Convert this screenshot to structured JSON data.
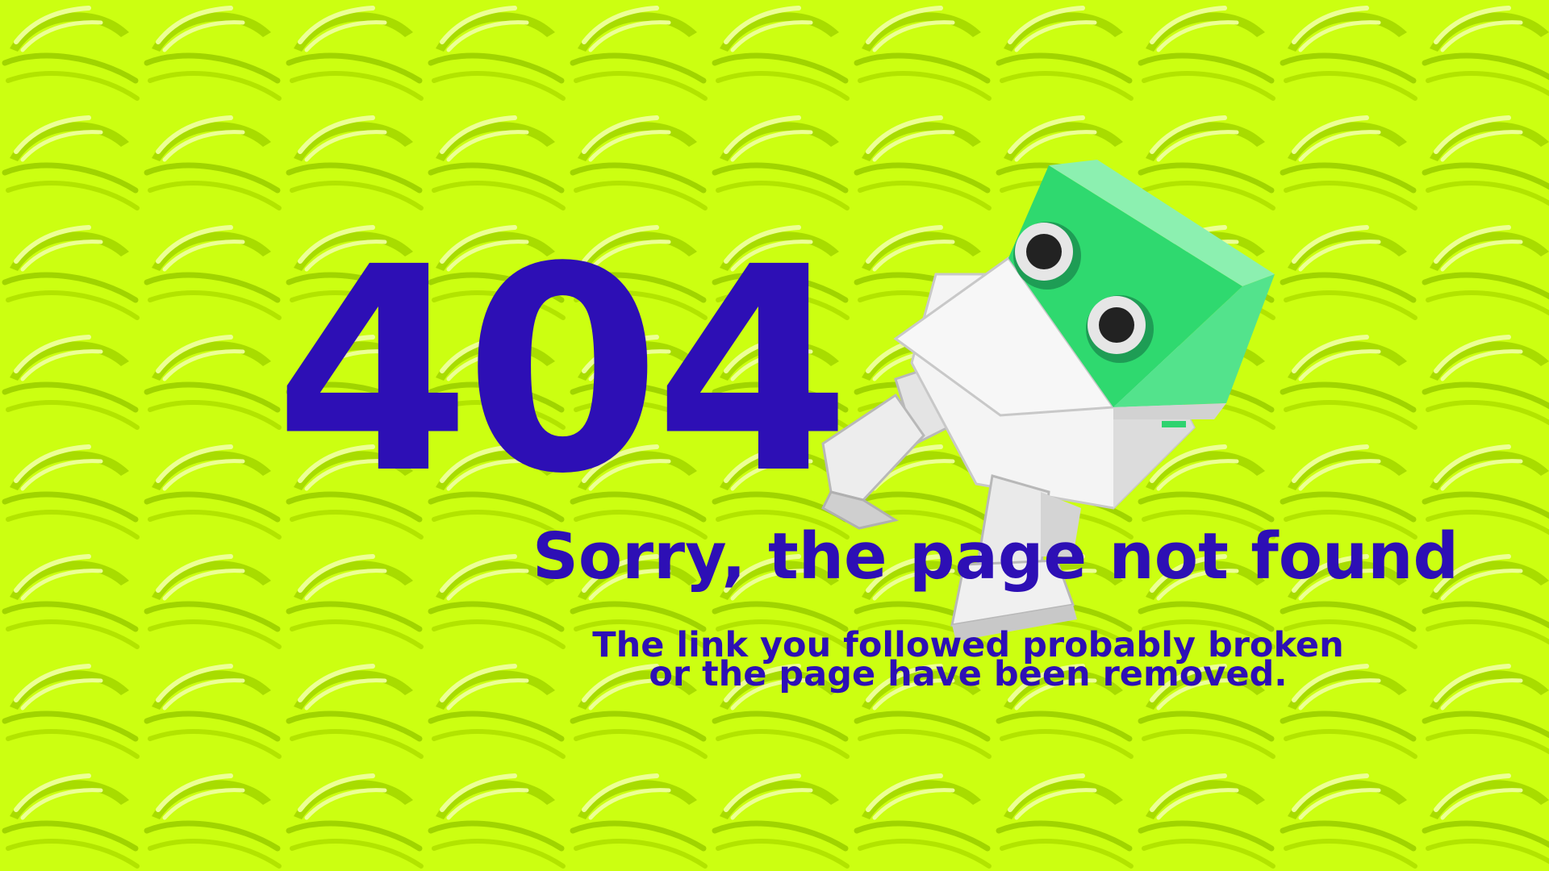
{
  "colors": {
    "background": "#ccff11",
    "pattern_dark": "#9fd400",
    "pattern_light": "#e9ff8a",
    "text": "#2d0fb5",
    "robot_green": "#20d968",
    "robot_white": "#f2f2f2"
  },
  "error": {
    "code": "404",
    "title": "Sorry, the page not found",
    "line1": "The link you  followed probably broken",
    "line2": "or the page have  been removed."
  },
  "illustration": {
    "icon": "robot-mascot-icon"
  }
}
